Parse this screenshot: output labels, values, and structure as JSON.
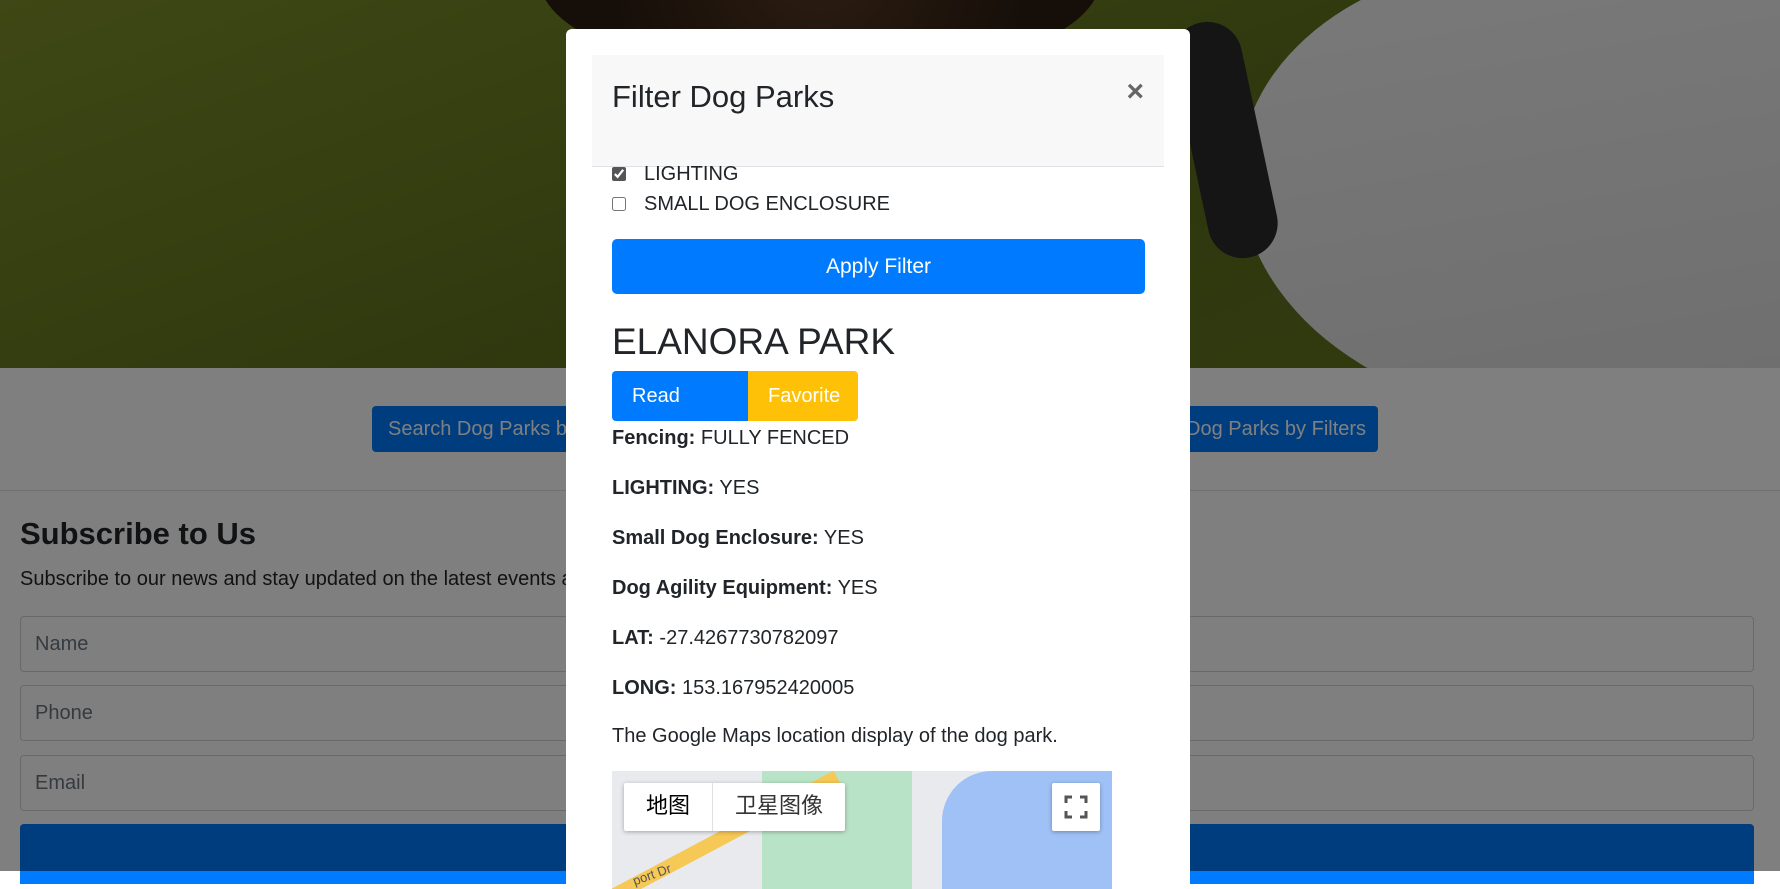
{
  "background_page": {
    "buttons": {
      "search_by_name": "Search Dog Parks by",
      "search_by_filters": "Dog Parks by Filters"
    },
    "subscribe": {
      "title": "Subscribe to Us",
      "text": "Subscribe to our news and stay updated on the latest events a",
      "name_placeholder": "Name",
      "phone_placeholder": "Phone",
      "email_placeholder": "Email"
    }
  },
  "modal": {
    "title": "Filter Dog Parks",
    "close_label": "×",
    "filters": [
      {
        "label": "LIGHTING",
        "checked": true
      },
      {
        "label": "SMALL DOG ENCLOSURE",
        "checked": false
      }
    ],
    "apply_label": "Apply Filter",
    "park": {
      "name": "ELANORA PARK",
      "read_more_label": "Read More",
      "favorite_label": "Favorite",
      "details": [
        {
          "label": "Fencing:",
          "value": "FULLY FENCED"
        },
        {
          "label": "LIGHTING:",
          "value": "YES"
        },
        {
          "label": "Small Dog Enclosure:",
          "value": "YES"
        },
        {
          "label": "Dog Agility Equipment:",
          "value": "YES"
        },
        {
          "label": "LAT:",
          "value": "-27.4267730782097"
        },
        {
          "label": "LONG:",
          "value": "153.167952420005"
        }
      ],
      "map_caption": "The Google Maps location display of the dog park.",
      "map": {
        "type_map": "地图",
        "type_satellite": "卫星图像",
        "road_label": "port Dr",
        "fullscreen_icon": "fullscreen-icon"
      }
    }
  },
  "colors": {
    "primary": "#007bff",
    "warning": "#ffc107",
    "backdrop": "rgba(0,0,0,0.5)"
  }
}
